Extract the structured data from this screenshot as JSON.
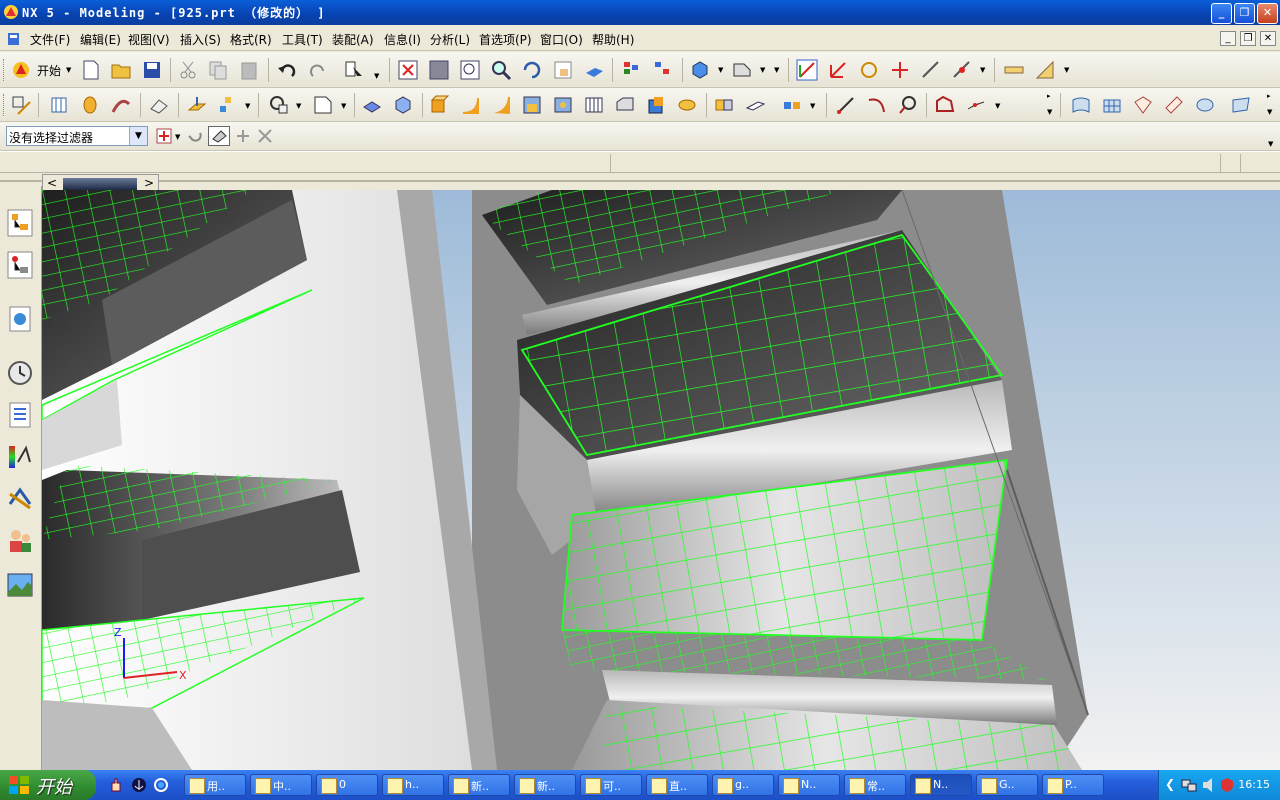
{
  "window": {
    "title": "NX 5 - Modeling - [925.prt （修改的） ]",
    "controls": [
      "_",
      "❐",
      "✕"
    ]
  },
  "menu": {
    "items": [
      "文件(F)",
      "编辑(E)",
      "视图(V)",
      "插入(S)",
      "格式(R)",
      "工具(T)",
      "装配(A)",
      "信息(I)",
      "分析(L)",
      "首选项(P)",
      "窗口(O)",
      "帮助(H)"
    ],
    "mdi_controls": [
      "_",
      "❐",
      "✕"
    ]
  },
  "toolbar": {
    "start_label": "开始"
  },
  "selection": {
    "filter_value": "没有选择过滤器"
  },
  "resource_bar": {
    "icons": [
      "assembly-navigator-icon",
      "part-navigator-icon",
      "web-browser-icon",
      "history-icon",
      "reuse-library-icon",
      "visualization-icon",
      "process-studio-icon",
      "roles-icon",
      "system-scenes-icon"
    ]
  },
  "viewport": {
    "axis_labels": {
      "z": "Z",
      "x": "X"
    },
    "colors": {
      "wireframe": "#22ff22",
      "background_top": "#9dbbd9",
      "background_bottom": "#f2f2f2",
      "shaded_face": "#8a8a8a"
    }
  },
  "taskbar": {
    "start_label": "开始",
    "tasks": [
      {
        "label": "用..",
        "icon": "word-doc-icon"
      },
      {
        "label": "中..",
        "icon": "browser-icon"
      },
      {
        "label": "0",
        "icon": "folder-icon"
      },
      {
        "label": "h..",
        "icon": "word-doc-icon"
      },
      {
        "label": "新..",
        "icon": "document-icon"
      },
      {
        "label": "新..",
        "icon": "browser-icon"
      },
      {
        "label": "可..",
        "icon": "drive-icon"
      },
      {
        "label": "直..",
        "icon": "folder-icon"
      },
      {
        "label": "g..",
        "icon": "folder-icon"
      },
      {
        "label": "N..",
        "icon": "app-icon"
      },
      {
        "label": "常..",
        "icon": "folder-icon"
      },
      {
        "label": "N..",
        "icon": "nx-icon"
      },
      {
        "label": "G..",
        "icon": "app-icon"
      },
      {
        "label": "P..",
        "icon": "app-icon"
      }
    ],
    "clock": "16:15"
  }
}
